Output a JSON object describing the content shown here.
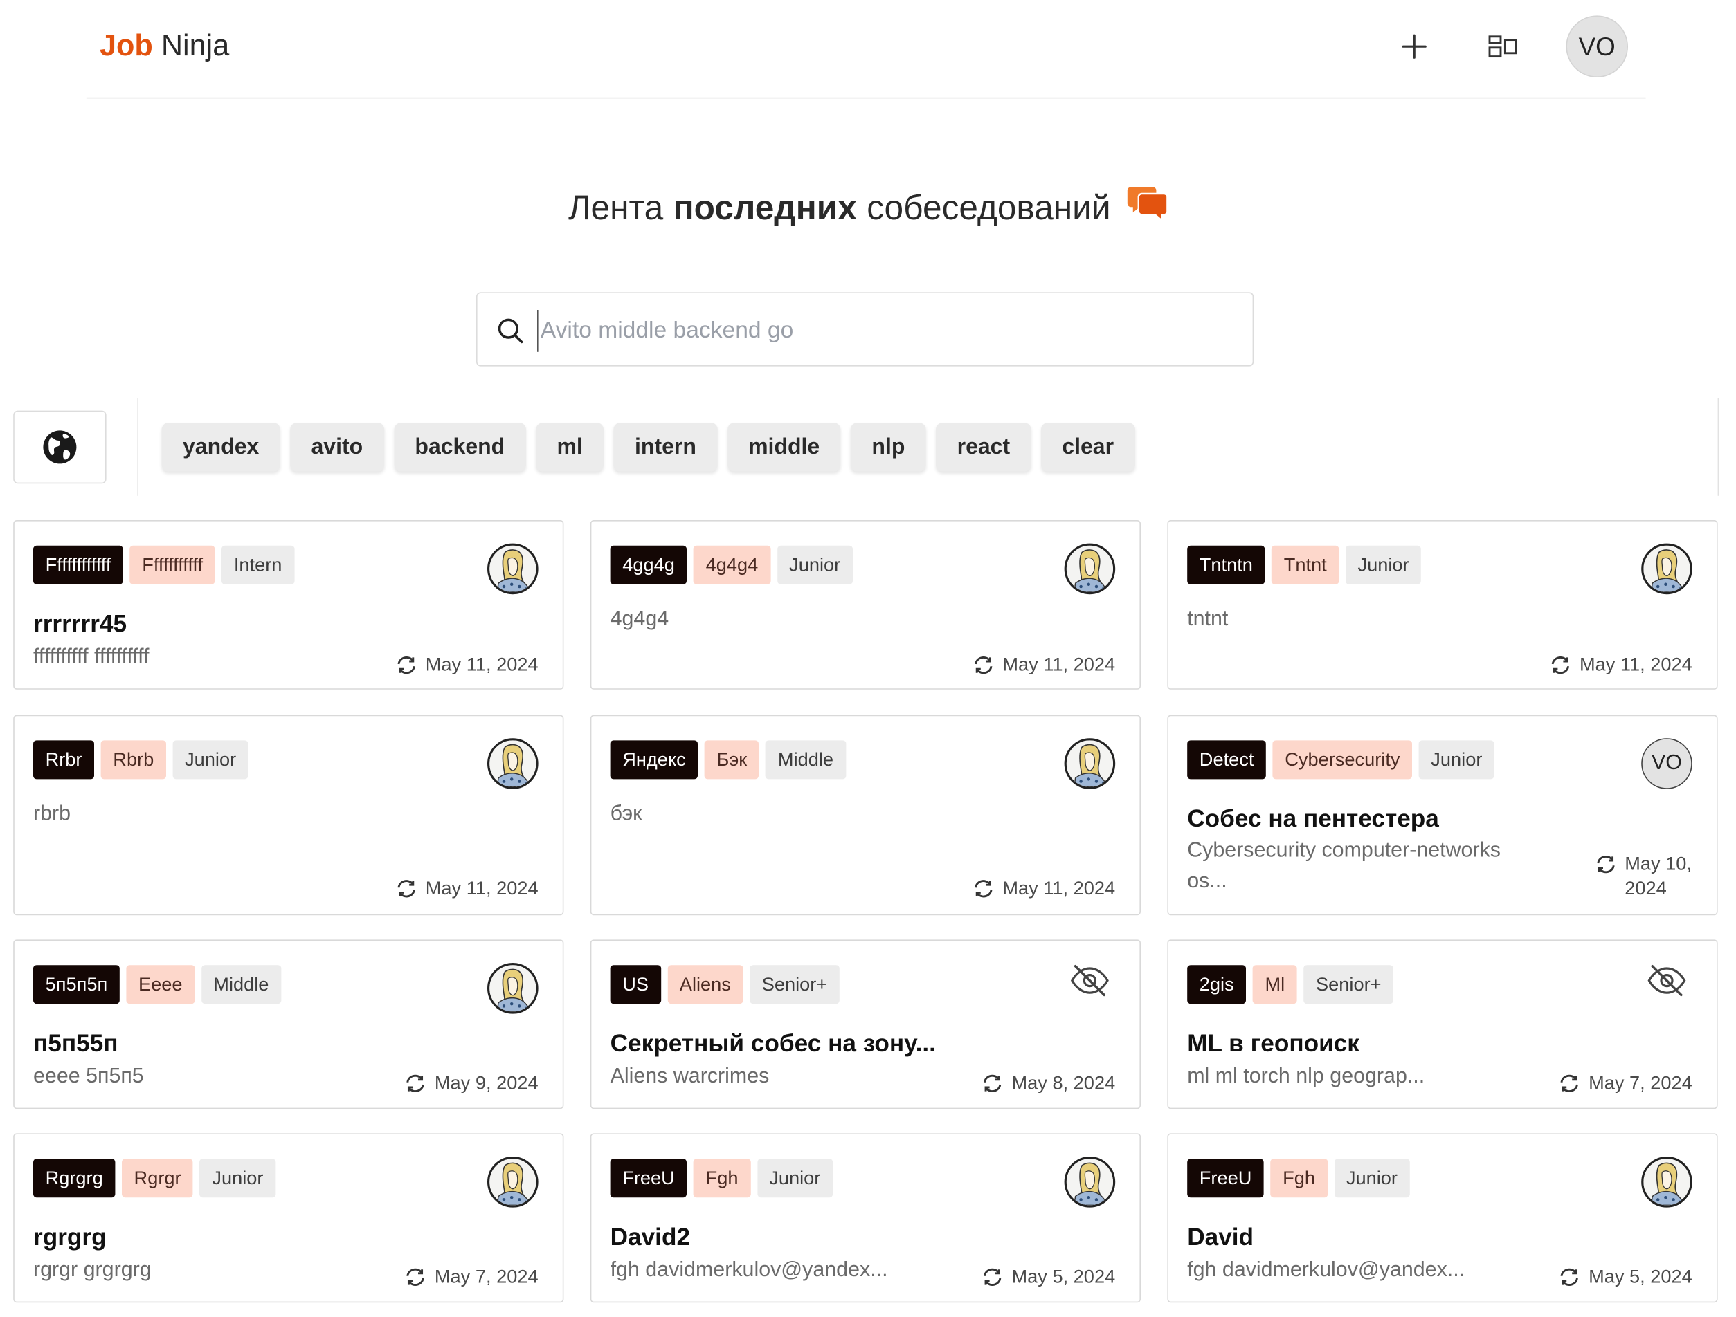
{
  "header": {
    "logo_job": "Job",
    "logo_ninja": "Ninja",
    "add_icon": "plus-icon",
    "layout_icon": "layout-toggle-icon",
    "user_initials": "VO"
  },
  "hero": {
    "title_pre": "Лента",
    "title_bold": "последних",
    "title_post": "собеседований",
    "title_icon": "chat-bubbles-icon"
  },
  "search": {
    "placeholder": "Avito middle backend go",
    "value": ""
  },
  "filters": {
    "globe_icon": "globe-icon",
    "chips": [
      "yandex",
      "avito",
      "backend",
      "ml",
      "intern",
      "middle",
      "nlp",
      "react",
      "clear"
    ]
  },
  "colors": {
    "accent": "#e3530f",
    "company_tag_bg": "#140705",
    "role_tag_bg": "#fdd7cb",
    "level_tag_bg": "#ececec"
  },
  "cards": [
    {
      "company": "Ffffffffffff",
      "role": "Fffffffffff",
      "level": "Intern",
      "title": "rrrrrrr45",
      "desc": "ffffffffff ffffffffff",
      "date": "May 11, 2024",
      "avatar": "photo"
    },
    {
      "company": "4gg4g",
      "role": "4g4g4",
      "level": "Junior",
      "title": "",
      "desc": "4g4g4",
      "date": "May 11, 2024",
      "avatar": "photo"
    },
    {
      "company": "Tntntn",
      "role": "Tntnt",
      "level": "Junior",
      "title": "",
      "desc": "tntnt",
      "date": "May 11, 2024",
      "avatar": "photo"
    },
    {
      "company": "Rrbr",
      "role": "Rbrb",
      "level": "Junior",
      "title": "",
      "desc": "rbrb",
      "date": "May 11, 2024",
      "avatar": "photo"
    },
    {
      "company": "Яндекс",
      "role": "Бэк",
      "level": "Middle",
      "title": "",
      "desc": "бэк",
      "date": "May 11, 2024",
      "avatar": "photo"
    },
    {
      "company": "Detect",
      "role": "Cybersecurity",
      "level": "Junior",
      "title": "Собес на пентестера",
      "desc": "Cybersecurity computer-networks os...",
      "date": "May 10, 2024",
      "avatar": "VO"
    },
    {
      "company": "5п5п5п",
      "role": "Eeee",
      "level": "Middle",
      "title": "п5п55п",
      "desc": "eeee 5п5п5",
      "date": "May 9, 2024",
      "avatar": "photo"
    },
    {
      "company": "US",
      "role": "Aliens",
      "level": "Senior+",
      "title": "Секретный собес на зону...",
      "desc": "Aliens warcrimes",
      "date": "May 8, 2024",
      "avatar": "hidden"
    },
    {
      "company": "2gis",
      "role": "Ml",
      "level": "Senior+",
      "title": "ML в геопоиск",
      "desc": "ml ml torch nlp geograp...",
      "date": "May 7, 2024",
      "avatar": "hidden"
    },
    {
      "company": "Rgrgrg",
      "role": "Rgrgr",
      "level": "Junior",
      "title": "rgrgrg",
      "desc": "rgrgr grgrgrg",
      "date": "May 7, 2024",
      "avatar": "photo"
    },
    {
      "company": "FreeU",
      "role": "Fgh",
      "level": "Junior",
      "title": "David2",
      "desc": "fgh davidmerkulov@yandex...",
      "date": "May 5, 2024",
      "avatar": "photo"
    },
    {
      "company": "FreeU",
      "role": "Fgh",
      "level": "Junior",
      "title": "David",
      "desc": "fgh davidmerkulov@yandex...",
      "date": "May 5, 2024",
      "avatar": "photo"
    }
  ]
}
